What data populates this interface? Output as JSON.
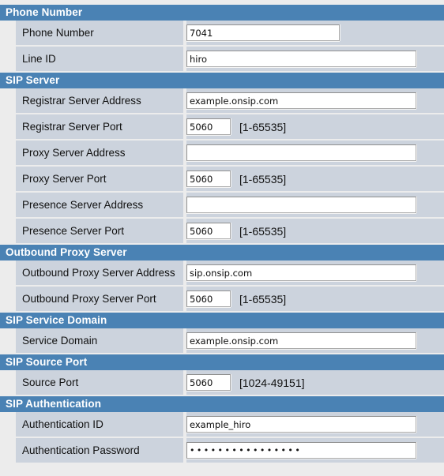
{
  "page": {
    "accent_color": "#4a82b4",
    "label_cell_color": "#ccd3dd",
    "page_background": "#ececec",
    "field_background": "#ffffff"
  },
  "sections": [
    {
      "title": "Phone Number",
      "rows": [
        {
          "label": "Phone Number",
          "value": "7041",
          "hint": "",
          "field_size": "medium"
        },
        {
          "label": "Line ID",
          "value": "hiro",
          "hint": "",
          "field_size": "wide"
        }
      ]
    },
    {
      "title": "SIP Server",
      "rows": [
        {
          "label": "Registrar Server Address",
          "value": "example.onsip.com",
          "hint": "",
          "field_size": "wide"
        },
        {
          "label": "Registrar Server Port",
          "value": "5060",
          "hint": "[1-65535]",
          "field_size": "port"
        },
        {
          "label": "Proxy Server Address",
          "value": "",
          "hint": "",
          "field_size": "wide"
        },
        {
          "label": "Proxy Server Port",
          "value": "5060",
          "hint": "[1-65535]",
          "field_size": "port"
        },
        {
          "label": "Presence Server Address",
          "value": "",
          "hint": "",
          "field_size": "wide"
        },
        {
          "label": "Presence Server Port",
          "value": "5060",
          "hint": "[1-65535]",
          "field_size": "port"
        }
      ]
    },
    {
      "title": "Outbound Proxy Server",
      "rows": [
        {
          "label": "Outbound Proxy Server Address",
          "value": "sip.onsip.com",
          "hint": "",
          "field_size": "wide"
        },
        {
          "label": "Outbound Proxy Server Port",
          "value": "5060",
          "hint": "[1-65535]",
          "field_size": "port"
        }
      ]
    },
    {
      "title": "SIP Service Domain",
      "rows": [
        {
          "label": "Service Domain",
          "value": "example.onsip.com",
          "hint": "",
          "field_size": "wide"
        }
      ]
    },
    {
      "title": "SIP Source Port",
      "rows": [
        {
          "label": "Source Port",
          "value": "5060",
          "hint": "[1024-49151]",
          "field_size": "port"
        }
      ]
    },
    {
      "title": "SIP Authentication",
      "rows": [
        {
          "label": "Authentication ID",
          "value": "example_hiro",
          "hint": "",
          "field_size": "wide"
        },
        {
          "label": "Authentication Password",
          "value": "••••••••••••••••",
          "hint": "",
          "field_size": "wide",
          "masked": true
        }
      ]
    }
  ]
}
